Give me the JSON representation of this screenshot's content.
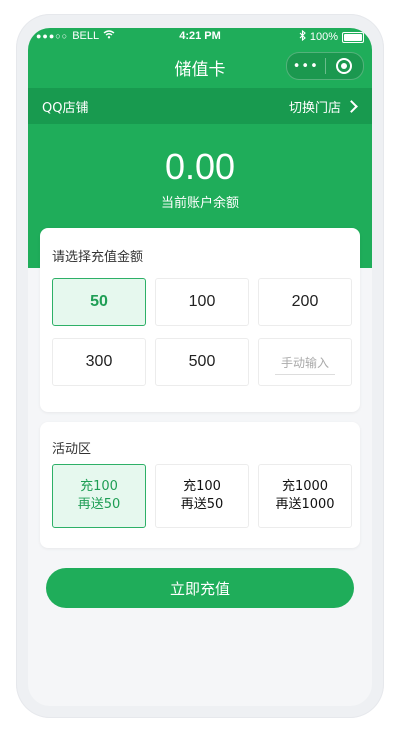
{
  "status_bar": {
    "carrier": "BELL",
    "time": "4:21 PM",
    "battery": "100%"
  },
  "nav": {
    "title": "储值卡",
    "more_label": "•••"
  },
  "store": {
    "name": "QQ店铺",
    "switch_label": "切换门店"
  },
  "balance": {
    "value": "0.00",
    "label": "当前账户余额"
  },
  "amount_section": {
    "title": "请选择充值金额",
    "options": [
      "50",
      "100",
      "200",
      "300",
      "500"
    ],
    "manual_placeholder": "手动输入"
  },
  "promo_section": {
    "title": "活动区",
    "options": [
      {
        "line1": "充100",
        "line2": "再送50"
      },
      {
        "line1": "充100",
        "line2": "再送50"
      },
      {
        "line1": "充1000",
        "line2": "再送1000"
      }
    ]
  },
  "submit_label": "立即充值",
  "colors": {
    "primary": "#1fad5a",
    "primary_dark": "#189a4f",
    "selected_bg": "#e6f8ee"
  }
}
